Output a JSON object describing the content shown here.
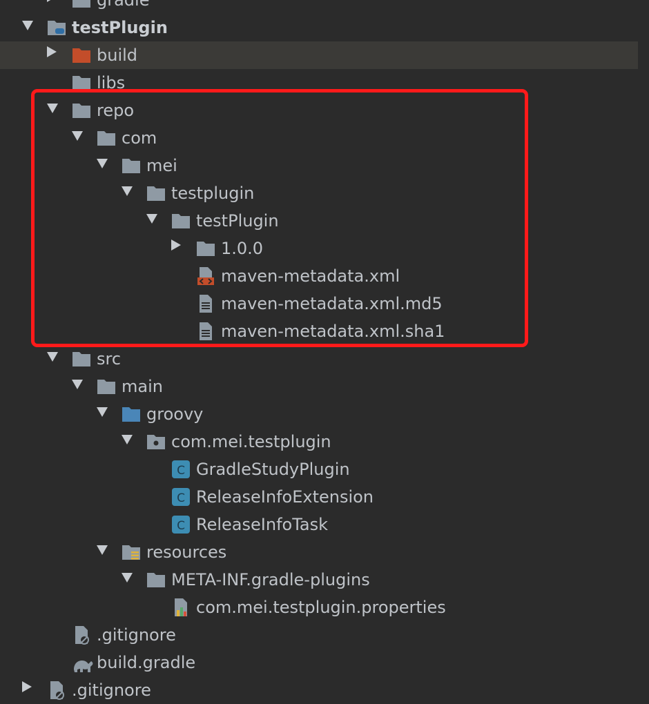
{
  "colors": {
    "background": "#2b2b2b",
    "text": "#bfc3c8",
    "folder": "#8f9aa4",
    "build_folder": "#c34d2a",
    "source_folder": "#4a86b8",
    "class_icon": "#3d8db3",
    "selection": "#3b3a37",
    "highlight_box": "#ff1a1a"
  },
  "tree": [
    {
      "label": "gradle",
      "icon": "folder-icon",
      "arrow": "right",
      "depth": 1
    },
    {
      "label": "testPlugin",
      "icon": "module-icon",
      "arrow": "down",
      "depth": 0,
      "bold": true
    },
    {
      "label": "build",
      "icon": "build-folder-icon",
      "arrow": "right",
      "depth": 1,
      "selected": true
    },
    {
      "label": "libs",
      "icon": "folder-icon",
      "arrow": "none",
      "depth": 1
    },
    {
      "label": "repo",
      "icon": "folder-icon",
      "arrow": "down",
      "depth": 1
    },
    {
      "label": "com",
      "icon": "folder-icon",
      "arrow": "down",
      "depth": 2
    },
    {
      "label": "mei",
      "icon": "folder-icon",
      "arrow": "down",
      "depth": 3
    },
    {
      "label": "testplugin",
      "icon": "folder-icon",
      "arrow": "down",
      "depth": 4
    },
    {
      "label": "testPlugin",
      "icon": "folder-icon",
      "arrow": "down",
      "depth": 5
    },
    {
      "label": "1.0.0",
      "icon": "folder-icon",
      "arrow": "right",
      "depth": 6
    },
    {
      "label": "maven-metadata.xml",
      "icon": "xml-file-icon",
      "arrow": "none",
      "depth": 6
    },
    {
      "label": "maven-metadata.xml.md5",
      "icon": "text-file-icon",
      "arrow": "none",
      "depth": 6
    },
    {
      "label": "maven-metadata.xml.sha1",
      "icon": "text-file-icon",
      "arrow": "none",
      "depth": 6
    },
    {
      "label": "src",
      "icon": "folder-icon",
      "arrow": "down",
      "depth": 1
    },
    {
      "label": "main",
      "icon": "folder-icon",
      "arrow": "down",
      "depth": 2
    },
    {
      "label": "groovy",
      "icon": "source-folder-icon",
      "arrow": "down",
      "depth": 3
    },
    {
      "label": "com.mei.testplugin",
      "icon": "package-icon",
      "arrow": "down",
      "depth": 4
    },
    {
      "label": "GradleStudyPlugin",
      "icon": "class-icon",
      "arrow": "none",
      "depth": 5
    },
    {
      "label": "ReleaseInfoExtension",
      "icon": "class-icon",
      "arrow": "none",
      "depth": 5
    },
    {
      "label": "ReleaseInfoTask",
      "icon": "class-icon",
      "arrow": "none",
      "depth": 5
    },
    {
      "label": "resources",
      "icon": "resources-folder-icon",
      "arrow": "down",
      "depth": 3
    },
    {
      "label": "META-INF.gradle-plugins",
      "icon": "folder-icon",
      "arrow": "down",
      "depth": 4
    },
    {
      "label": "com.mei.testplugin.properties",
      "icon": "properties-file-icon",
      "arrow": "none",
      "depth": 5
    },
    {
      "label": ".gitignore",
      "icon": "gitignore-file-icon",
      "arrow": "none",
      "depth": 1
    },
    {
      "label": "build.gradle",
      "icon": "gradle-file-icon",
      "arrow": "none",
      "depth": 1
    },
    {
      "label": ".gitignore",
      "icon": "gitignore-file-icon",
      "arrow": "right",
      "depth": 0
    }
  ]
}
